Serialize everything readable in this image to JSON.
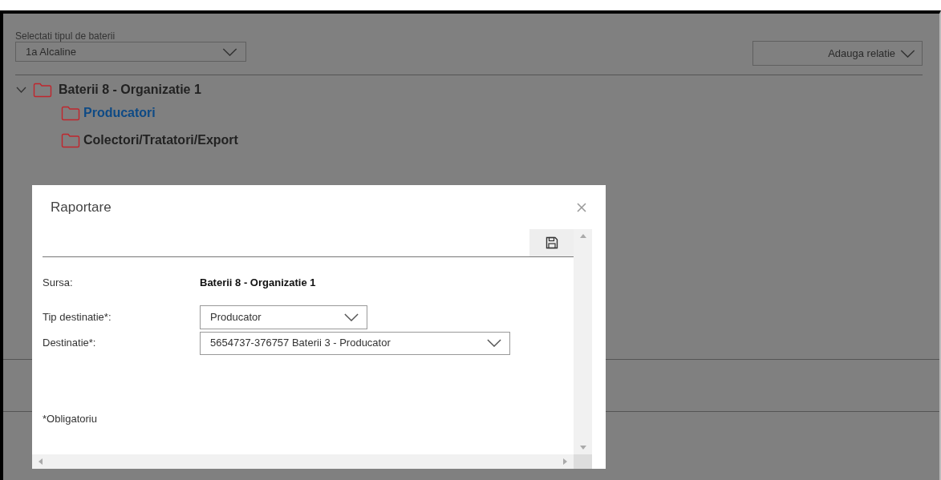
{
  "page": {
    "battery_type": {
      "label": "Selectati tipul de baterii",
      "value": "1a Alcaline"
    },
    "add_relation_button": "Adauga relatie",
    "tree": [
      {
        "label": "Baterii 8 - Organizatie 1",
        "expanded": true,
        "selected": false,
        "children": [
          {
            "label": "Producatori",
            "selected": true
          },
          {
            "label": "Colectori/Tratatori/Export",
            "selected": false
          }
        ]
      }
    ]
  },
  "dialog": {
    "title": "Raportare",
    "fields": [
      {
        "kind": "text",
        "label": "Sursa:",
        "value": "Baterii 8 - Organizatie 1"
      },
      {
        "kind": "select",
        "label": "Tip destinatie*:",
        "value": "Producator"
      },
      {
        "kind": "select",
        "label": "Destinatie*:",
        "value": "5654737-376757 Baterii 3 - Producator"
      }
    ],
    "note": "*Obligatoriu"
  }
}
